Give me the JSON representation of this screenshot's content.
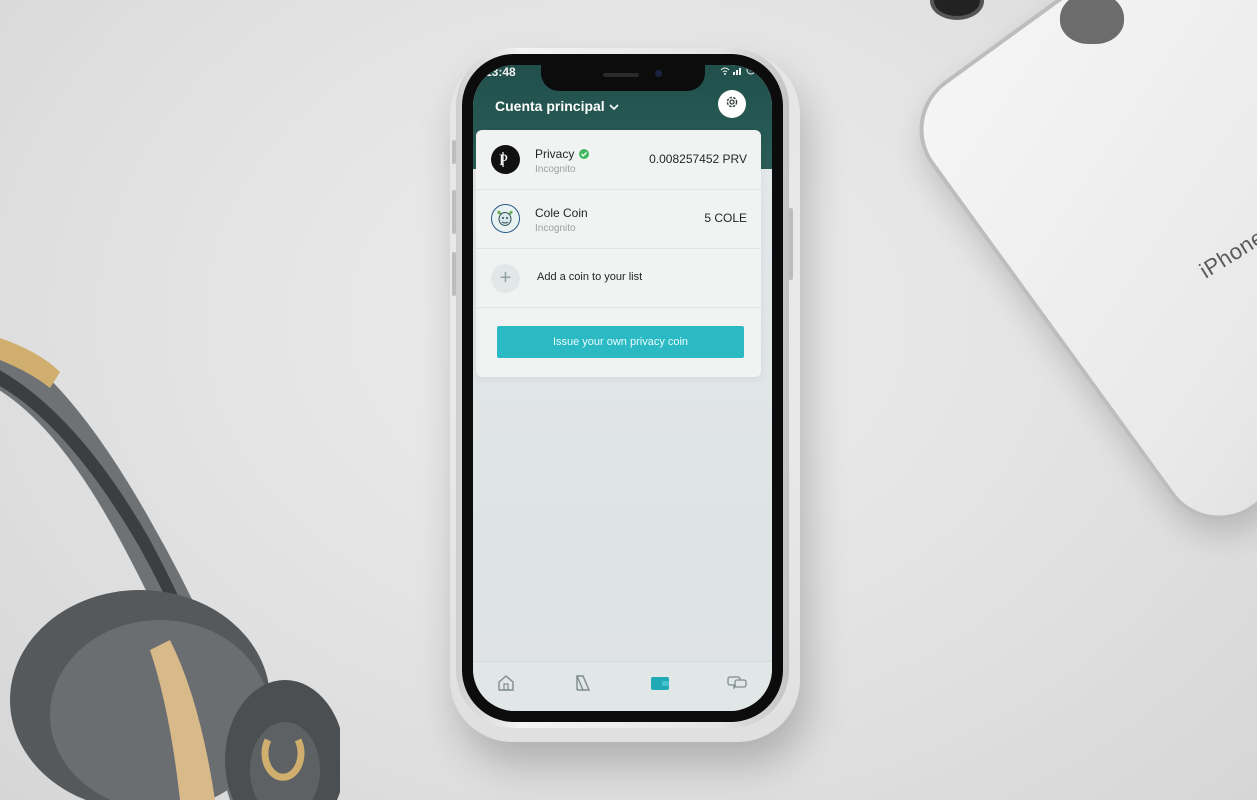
{
  "status_bar": {
    "time": "13:48"
  },
  "header": {
    "account_label": "Cuenta principal"
  },
  "coins": [
    {
      "name": "Privacy",
      "network": "Incognito",
      "amount": "0.008257452 PRV",
      "verified": true,
      "icon": "privacy-coin-icon"
    },
    {
      "name": "Cole Coin",
      "network": "Incognito",
      "amount": "5 COLE",
      "verified": false,
      "icon": "cole-coin-icon"
    }
  ],
  "add_coin": {
    "label": "Add a coin to your list"
  },
  "issue_button": {
    "label": "Issue your own privacy coin"
  },
  "bottom_nav": [
    {
      "icon": "home-icon"
    },
    {
      "icon": "trade-icon"
    },
    {
      "icon": "wallet-icon",
      "active": true
    },
    {
      "icon": "chat-icon"
    }
  ],
  "background": {
    "device_text": "iPhone"
  },
  "colors": {
    "header": "#21504c",
    "accent": "#2bb9c4",
    "verified": "#3fb85f"
  }
}
